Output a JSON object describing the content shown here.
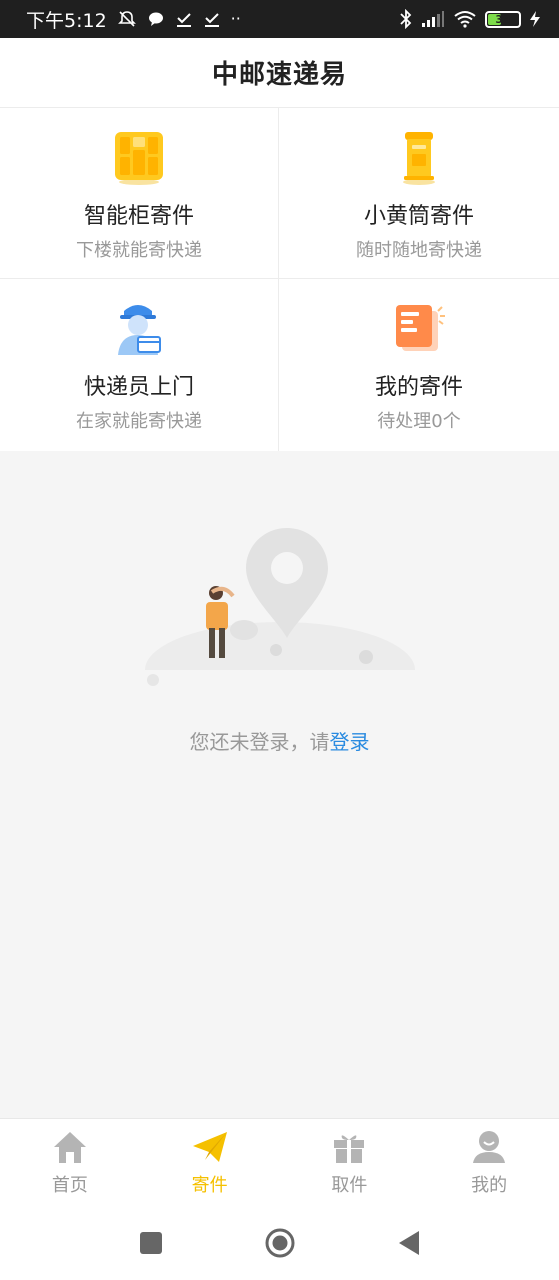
{
  "status_bar": {
    "time": "下午5:12",
    "battery": "39",
    "left_icons": [
      "mute-bell-icon",
      "chat-bubble-icon",
      "download-check-icon",
      "download-check-icon",
      "more-dots-icon"
    ],
    "right_icons": [
      "bluetooth-icon",
      "signal-icon",
      "wifi-icon",
      "battery-icon",
      "charging-icon"
    ]
  },
  "header": {
    "title": "中邮速递易"
  },
  "services": [
    {
      "title": "智能柜寄件",
      "subtitle": "下楼就能寄快递",
      "icon": "locker-icon"
    },
    {
      "title": "小黄筒寄件",
      "subtitle": "随时随地寄快递",
      "icon": "mailbox-icon"
    },
    {
      "title": "快递员上门",
      "subtitle": "在家就能寄快递",
      "icon": "courier-icon"
    },
    {
      "title": "我的寄件",
      "subtitle": "待处理0个",
      "icon": "document-icon"
    }
  ],
  "empty_state": {
    "message": "您还未登录，请",
    "login_link": "登录"
  },
  "bottom_nav": {
    "items": [
      {
        "label": "首页",
        "icon": "home-icon",
        "active": false
      },
      {
        "label": "寄件",
        "icon": "paper-plane-icon",
        "active": true
      },
      {
        "label": "取件",
        "icon": "gift-icon",
        "active": false
      },
      {
        "label": "我的",
        "icon": "user-icon",
        "active": false
      }
    ]
  },
  "colors": {
    "accent": "#f5c000",
    "link": "#2a8be0",
    "muted_text": "#999999",
    "background": "#f5f5f5"
  }
}
